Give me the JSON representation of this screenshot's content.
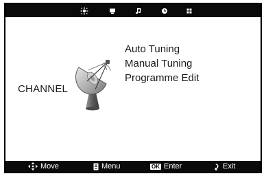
{
  "topbar": {
    "icons": [
      "picture-icon",
      "screen-icon",
      "music-note-icon",
      "clock-icon",
      "grid-icon"
    ],
    "active_index": 0
  },
  "category": "CHANNEL",
  "menu": {
    "items": [
      {
        "label": "Auto Tuning"
      },
      {
        "label": "Manual Tuning"
      },
      {
        "label": "Programme Edit"
      }
    ]
  },
  "footer": {
    "move": "Move",
    "menu": "Menu",
    "ok_key": "OK",
    "enter": "Enter",
    "exit": "Exit"
  }
}
